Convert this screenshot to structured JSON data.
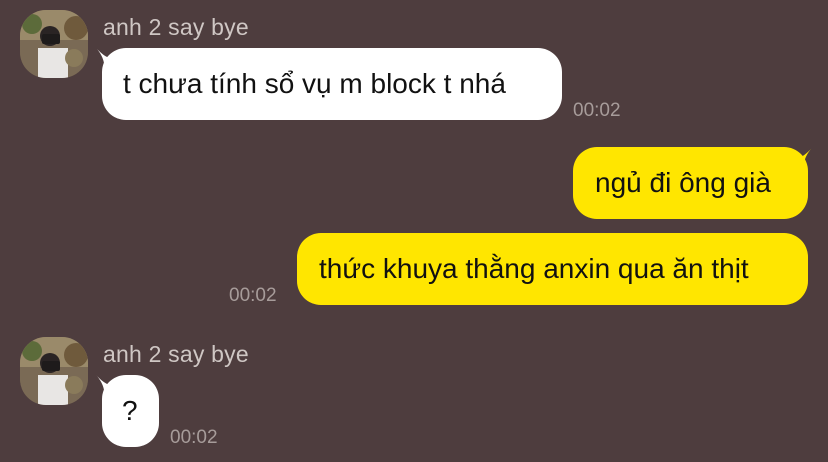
{
  "messages": [
    {
      "direction": "in",
      "sender": "anh 2 say bye",
      "text": "t chưa tính sổ vụ m block t nhá",
      "time": "00:02"
    },
    {
      "direction": "out",
      "text": "ngủ đi ông già",
      "time": ""
    },
    {
      "direction": "out",
      "text": "thức khuya thằng anxin qua ăn thịt",
      "time": "00:02"
    },
    {
      "direction": "in",
      "sender": "anh 2 say bye",
      "text": "?",
      "time": "00:02"
    }
  ],
  "colors": {
    "background": "#4e3d3e",
    "incoming_bubble": "#ffffff",
    "outgoing_bubble": "#ffe600",
    "sender_text": "#cfc7c4",
    "time_text": "#a79c9a"
  }
}
